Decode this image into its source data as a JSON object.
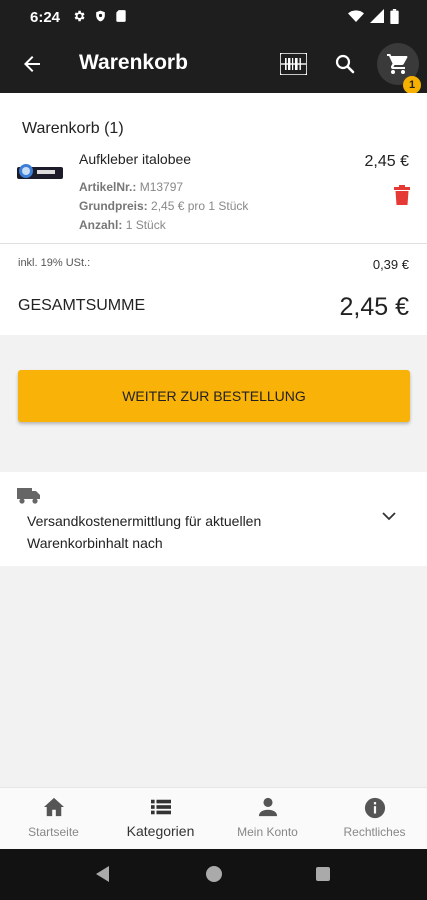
{
  "status_bar": {
    "time": "6:24",
    "left_icons": [
      "gear-icon",
      "shield-icon",
      "sim-card-icon"
    ],
    "right_icons": [
      "wifi-icon",
      "signal-icon",
      "battery-icon"
    ]
  },
  "app_bar": {
    "title": "Warenkorb",
    "cart_count": "1",
    "icons": [
      "back-arrow-icon",
      "barcode-scanner-icon",
      "search-icon",
      "cart-icon"
    ],
    "background": "#1e1e1e"
  },
  "cart": {
    "heading": "Warenkorb (1)",
    "items": [
      {
        "name": "Aufkleber italobee",
        "price": "2,45 €",
        "article_label": "ArtikelNr.:",
        "article_value": "M13797",
        "base_price_label": "Grundpreis:",
        "base_price_value": "2,45 € pro 1 Stück",
        "quantity_label": "Anzahl:",
        "quantity_value": "1 Stück"
      }
    ],
    "vat_label": "inkl. 19% USt.:",
    "vat_value": "0,39 €",
    "total_label": "GESAMTSUMME",
    "total_value": "2,45 €"
  },
  "order_button": {
    "label": "WEITER ZUR BESTELLUNG",
    "color": "#f9b208"
  },
  "shipping": {
    "text": "Versandkostenermittlung für aktuellen Warenkorbinhalt nach"
  },
  "bottom_nav": {
    "items": [
      {
        "label": "Startseite",
        "icon": "home-icon"
      },
      {
        "label": "Kategorien",
        "icon": "list-icon",
        "active": true
      },
      {
        "label": "Mein Konto",
        "icon": "person-icon"
      },
      {
        "label": "Rechtliches",
        "icon": "info-icon"
      }
    ]
  },
  "colors": {
    "accent": "#f9b208",
    "delete": "#e53935"
  }
}
